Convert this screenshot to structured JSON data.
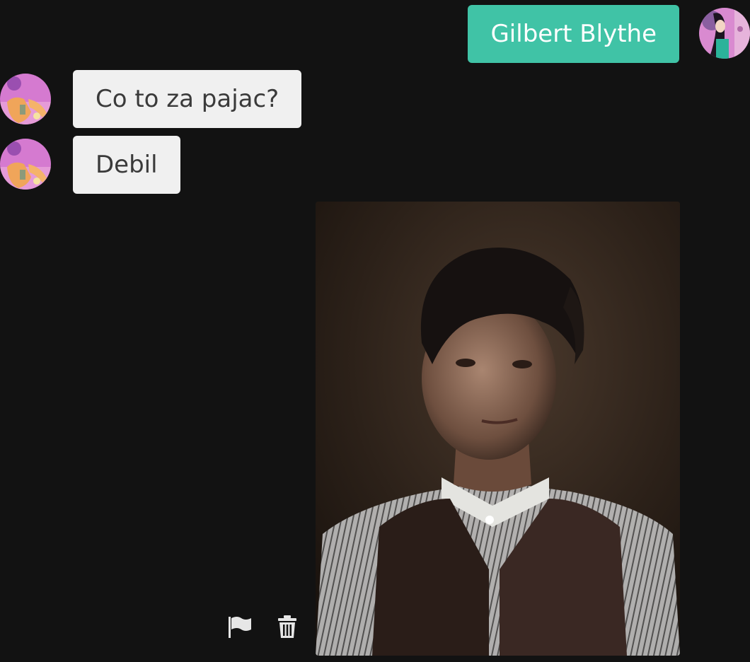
{
  "messages": [
    {
      "direction": "outgoing",
      "text": "Gilbert Blythe"
    },
    {
      "direction": "incoming",
      "text": "Co to za pajac?"
    },
    {
      "direction": "incoming",
      "text": "Debil"
    },
    {
      "direction": "incoming",
      "type": "image"
    }
  ],
  "colors": {
    "background": "#121212",
    "outgoing_bubble": "#40c3a6",
    "incoming_bubble": "#f0f0f0",
    "icon": "#e6e6e6"
  },
  "icons": {
    "report": "flag-icon",
    "delete": "trash-icon"
  }
}
